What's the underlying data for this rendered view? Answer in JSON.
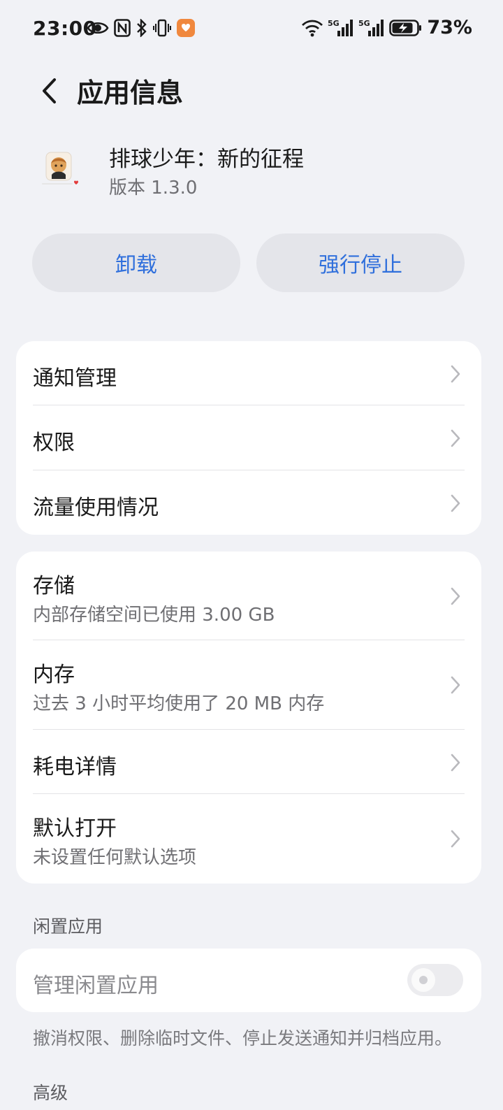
{
  "status_bar": {
    "time": "23:00",
    "battery_pct": "73%",
    "left_icons": [
      "eye-icon",
      "nfc-icon",
      "bluetooth-icon",
      "vibrate-icon",
      "app-notification-icon"
    ],
    "right_icons": [
      "wifi-icon",
      "signal-5g-1-icon",
      "signal-5g-2-icon",
      "battery-charging-icon"
    ],
    "signal_label_1": "5G",
    "signal_label_2": "5G"
  },
  "header": {
    "title": "应用信息",
    "back_icon": "chevron-left-icon"
  },
  "app": {
    "name": "排球少年：新的征程",
    "version": "版本 1.3.0"
  },
  "actions": {
    "uninstall": "卸载",
    "force_stop": "强行停止"
  },
  "card1": {
    "items": [
      {
        "title": "通知管理"
      },
      {
        "title": "权限"
      },
      {
        "title": "流量使用情况"
      }
    ]
  },
  "card2": {
    "items": [
      {
        "title": "存储",
        "subtitle": "内部存储空间已使用 3.00 GB"
      },
      {
        "title": "内存",
        "subtitle": "过去 3 小时平均使用了 20 MB 内存"
      },
      {
        "title": "耗电详情"
      },
      {
        "title": "默认打开",
        "subtitle": "未设置任何默认选项"
      }
    ]
  },
  "idle": {
    "section_label": "闲置应用",
    "manage_label": "管理闲置应用",
    "toggle_on": false,
    "description": "撤消权限、删除临时文件、停止发送通知并归档应用。"
  },
  "advanced": {
    "section_label": "高级"
  },
  "colors": {
    "accent": "#2f6fdc",
    "background": "#f1f2f6",
    "card": "#ffffff",
    "button_bg": "#e4e5ea"
  }
}
